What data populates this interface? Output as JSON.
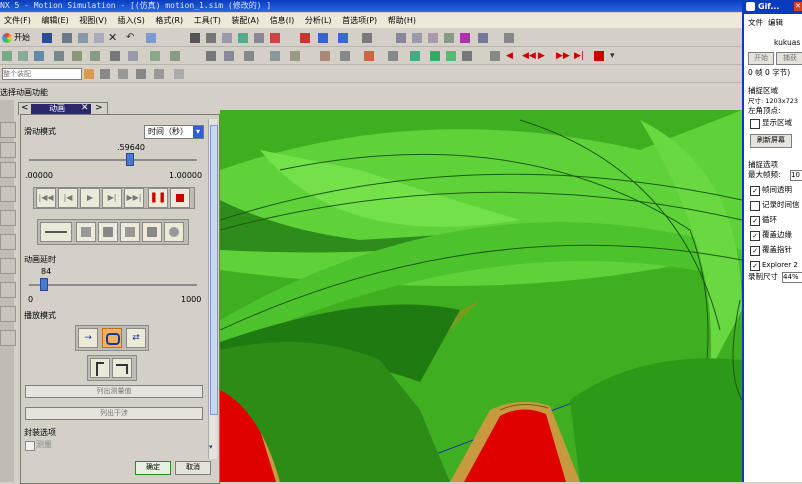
{
  "window": {
    "title": "NX 5 - Motion Simulation - [(仿真) motion_1.sim (修改的) ]"
  },
  "menubar": {
    "items": [
      "文件(F)",
      "编辑(E)",
      "视图(V)",
      "插入(S)",
      "格式(R)",
      "工具(T)",
      "装配(A)",
      "信息(I)",
      "分析(L)",
      "首选项(P)",
      "帮助(H)"
    ]
  },
  "toolbar": {
    "start_label": "开始",
    "filter_placeholder": "整个装配",
    "status_text": "选择动画功能"
  },
  "dialog": {
    "tab_label": "动画",
    "slider_mode_label": "滑动模式",
    "slider_mode_value": "时间（秒）",
    "slider_value": ".59640",
    "slider_fraction": 0.5964,
    "slider_min": ".00000",
    "slider_max": "1.00000",
    "delay_label": "动画延时",
    "delay_value": "84",
    "delay_fraction": 0.084,
    "delay_min": "0",
    "delay_max": "1000",
    "playback_label": "播放模式",
    "list_measure_button": "列出测量值",
    "list_interference_button": "列出干涉",
    "package_options_label": "封装选项",
    "measure_checkbox_label": "测量",
    "ok_button": "确定",
    "cancel_button": "取消"
  },
  "gif_panel": {
    "title": "Gif...",
    "menu_file": "文件",
    "menu_edit": "编辑",
    "site_text": "kukuas",
    "start_button": "开始",
    "capture_button": "捕获",
    "status": "0 帧 0 字节)",
    "capture_area_header": "捕捉区域",
    "size_text": "尺寸: 1203x723",
    "top_left_label": "左角顶点:",
    "show_area_label": "显示区域",
    "refresh_button": "刷新屏幕",
    "capture_options_header": "捕捉选项",
    "max_fps_label": "最大帧频:",
    "max_fps_value": "10",
    "transparent_label": "帧间透明",
    "record_time_label": "记录时间信",
    "loop_label": "循环",
    "cover_border_label": "覆盖边缘",
    "cover_pointer_label": "覆盖指针",
    "explorer_label": "Explorer 2",
    "record_size_label": "录制尺寸",
    "record_size_value": "44%"
  },
  "colors": {
    "viewport_green": "#3fae20",
    "gear_red": "#e00000",
    "gear_tan": "#c89a40",
    "accent_blue": "#0a3bbf"
  }
}
